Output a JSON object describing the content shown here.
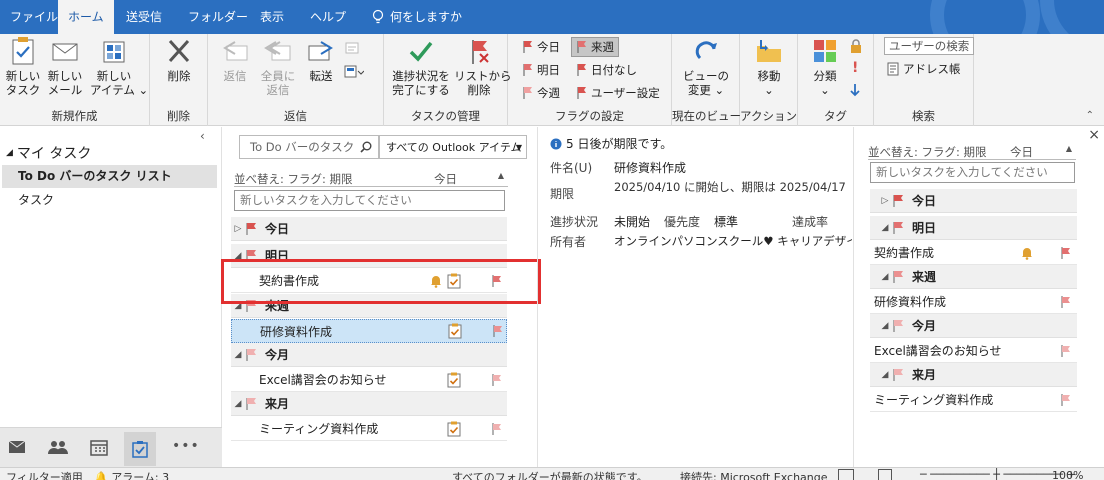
{
  "ribbon_tabs": [
    {
      "label": "ファイル"
    },
    {
      "label": "ホーム"
    },
    {
      "label": "送受信"
    },
    {
      "label": "フォルダー"
    },
    {
      "label": "表示"
    },
    {
      "label": "ヘルプ"
    },
    {
      "label": "何をしますか"
    }
  ],
  "ribbon": {
    "new": {
      "new_task": "新しい\nタスク",
      "new_mail": "新しい\nメール",
      "new_items": "新しい\nアイテム ⌄",
      "label": "新規作成"
    },
    "delete": {
      "delete": "削除",
      "label": "削除"
    },
    "respond": {
      "reply": "返信",
      "reply_all": "全員に\n返信",
      "forward": "転送",
      "label": "返信"
    },
    "manage": {
      "complete": "進捗状況を\n完了にする",
      "remove": "リストから\n削除",
      "label": "タスクの管理"
    },
    "follow": {
      "today": "今日",
      "this_week": "来週",
      "tomorrow": "明日",
      "no_date": "日付なし",
      "next_week": "今週",
      "custom": "ユーザー設定",
      "label": "フラグの設定"
    },
    "view": {
      "change": "ビューの\n変更 ⌄",
      "label": "現在のビュー"
    },
    "actions": {
      "move": "移動\n⌄",
      "label": "アクション"
    },
    "tags": {
      "categorize": "分類\n⌄",
      "label": "タグ"
    },
    "find": {
      "search_people": "ユーザーの検索",
      "address_book": "アドレス帳",
      "label": "検索"
    }
  },
  "left_pane": {
    "header": "マイ タスク",
    "items": [
      {
        "label": "To Do バーのタスク リスト"
      },
      {
        "label": "タスク"
      }
    ]
  },
  "task_list": {
    "search_placeholder": "To Do バーのタスク",
    "scope": "すべての Outlook アイテム",
    "sort_label": "並べ替え: フラグ: 期限",
    "sort_value": "今日",
    "new_task_placeholder": "新しいタスクを入力してください",
    "groups": [
      {
        "label": "今日",
        "tasks": []
      },
      {
        "label": "明日",
        "tasks": [
          {
            "title": "契約書作成"
          }
        ]
      },
      {
        "label": "来週",
        "tasks": [
          {
            "title": "研修資料作成"
          }
        ]
      },
      {
        "label": "今月",
        "tasks": [
          {
            "title": "Excel講習会のお知らせ"
          }
        ]
      },
      {
        "label": "来月",
        "tasks": [
          {
            "title": "ミーティング資料作成"
          }
        ]
      }
    ]
  },
  "reading_pane": {
    "info": "5 日後が期限です。",
    "subject_label": "件名(U)",
    "subject": "研修資料作成",
    "due_label": "期限",
    "due": "2025/04/10 に開始し、期限は 2025/04/17",
    "status_label": "進捗状況",
    "status": "未開始",
    "priority_label": "優先度",
    "priority": "標準",
    "percent_label": "達成率",
    "owner_label": "所有者",
    "owner": "オンラインパソコンスクール♥ キャリアデザイン"
  },
  "todo_bar": {
    "sort_label": "並べ替え: フラグ: 期限",
    "sort_value": "今日",
    "new_task_placeholder": "新しいタスクを入力してください",
    "groups": [
      {
        "label": "今日",
        "tasks": []
      },
      {
        "label": "明日",
        "tasks": [
          {
            "title": "契約書作成"
          }
        ]
      },
      {
        "label": "来週",
        "tasks": [
          {
            "title": "研修資料作成"
          }
        ]
      },
      {
        "label": "今月",
        "tasks": [
          {
            "title": "Excel講習会のお知らせ"
          }
        ]
      },
      {
        "label": "来月",
        "tasks": [
          {
            "title": "ミーティング資料作成"
          }
        ]
      }
    ]
  },
  "status_bar": {
    "filter": "フィルター適用",
    "reminders": "アラーム: 3",
    "sync": "すべてのフォルダーが最新の状態です。",
    "connection": "接続先: Microsoft Exchange",
    "zoom": "100%"
  },
  "colors": {
    "accent": "#2b6fc0",
    "flag": "#d9534f",
    "highlight": "#e23030",
    "selected_row": "#cce4f7"
  }
}
